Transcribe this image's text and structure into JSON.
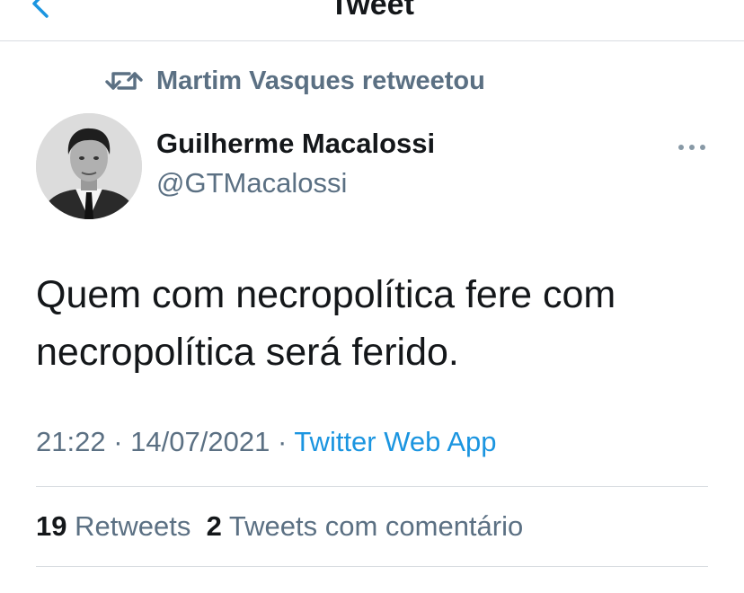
{
  "header": {
    "title": "Tweet",
    "back_icon": "chevron-left-icon"
  },
  "retweet_notice": {
    "icon": "retweet-icon",
    "text": "Martim Vasques retweetou"
  },
  "author": {
    "name": "Guilherme Macalossi",
    "handle": "@GTMacalossi",
    "avatar": "avatar-photo"
  },
  "tweet": {
    "text_line1": "Quem com necropolítica fere com",
    "text_line2": "necropolítica será ferido.",
    "time": "21:22",
    "date": "14/07/2021",
    "separator": "·",
    "source": "Twitter Web App"
  },
  "stats": {
    "retweets_count": "19",
    "retweets_label": "Retweets",
    "quotes_count": "2",
    "quotes_label": "Tweets com comentário"
  },
  "colors": {
    "accent": "#1b95e0",
    "secondary_text": "#5b7083",
    "primary_text": "#14171a",
    "divider": "#d9dde1"
  }
}
